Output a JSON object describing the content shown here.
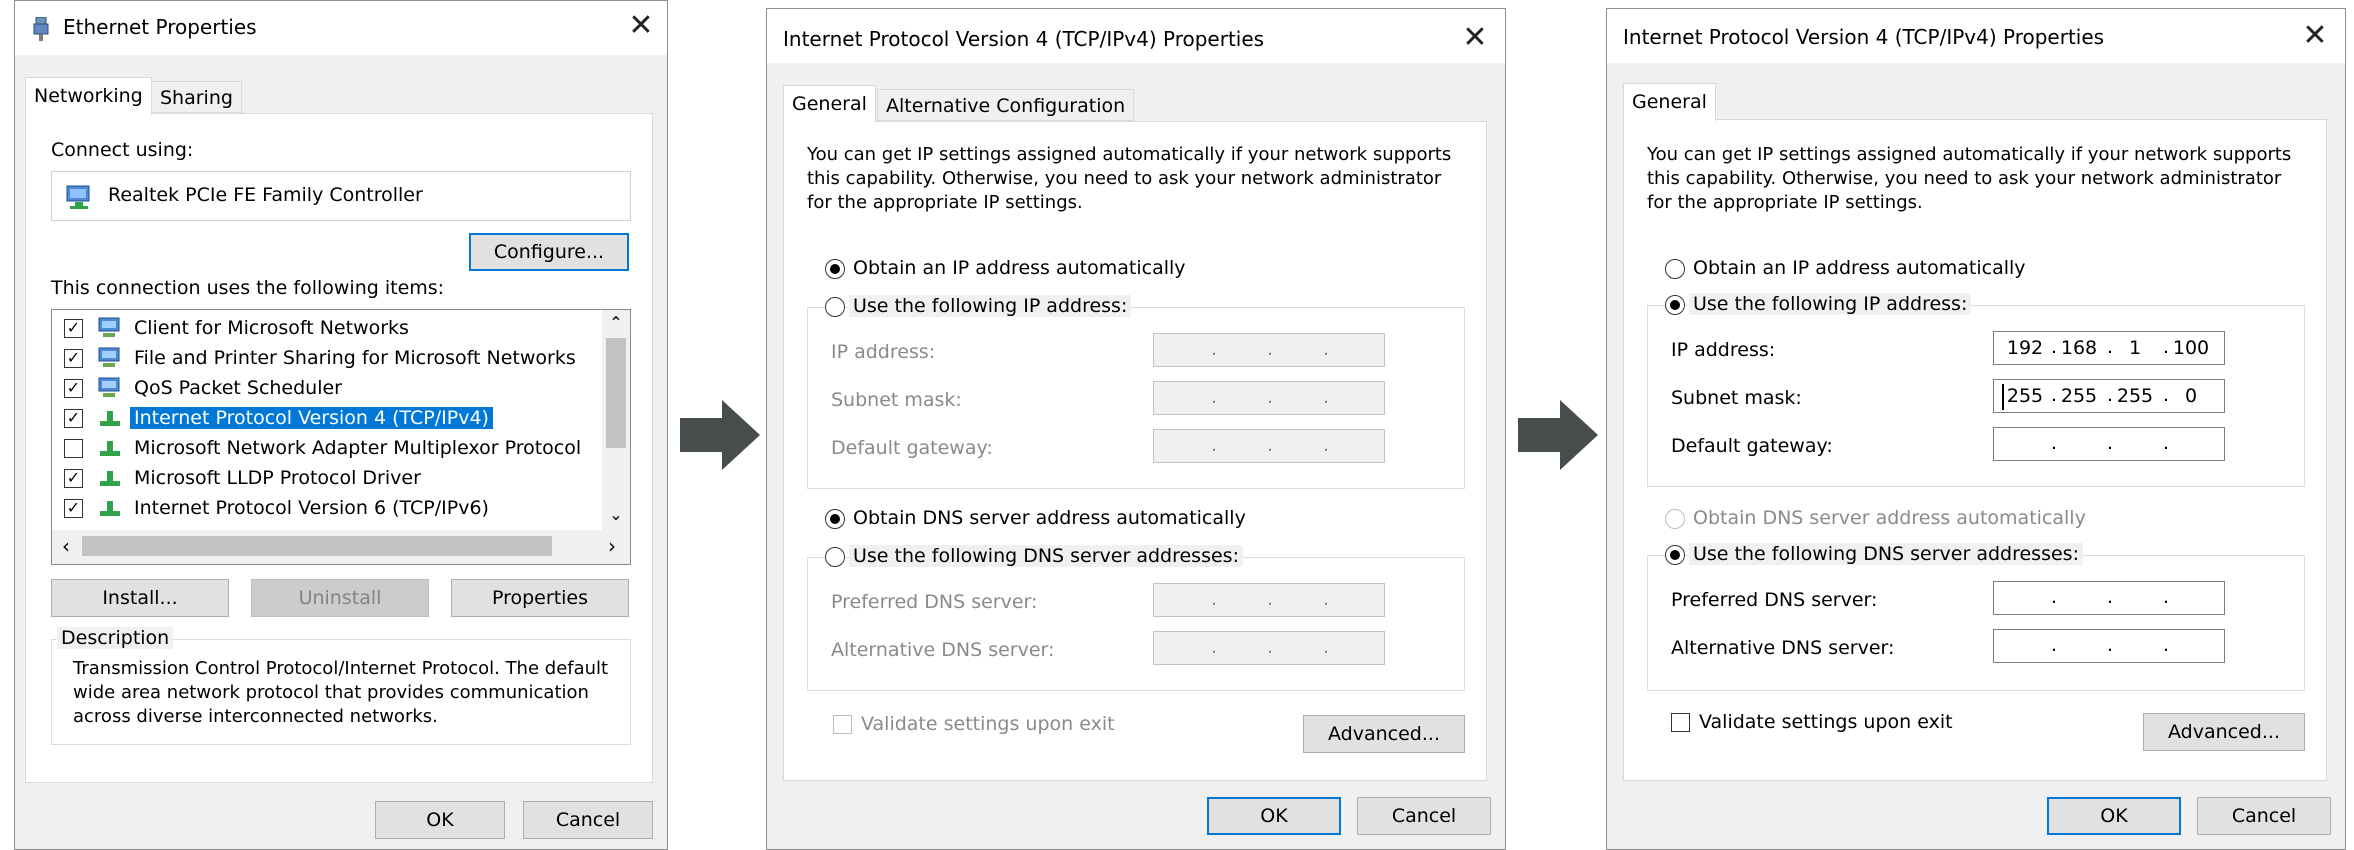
{
  "ethernet": {
    "title": "Ethernet Properties",
    "tabs": [
      "Networking",
      "Sharing"
    ],
    "connect_using_label": "Connect using:",
    "adapter_name": "Realtek PCIe FE Family Controller",
    "configure_button": "Configure...",
    "items_label": "This connection uses the following items:",
    "items": [
      {
        "label": "Client for Microsoft Networks",
        "checked": true
      },
      {
        "label": "File and Printer Sharing for Microsoft Networks",
        "checked": true
      },
      {
        "label": "QoS Packet Scheduler",
        "checked": true
      },
      {
        "label": "Internet Protocol Version 4 (TCP/IPv4)",
        "checked": true,
        "selected": true
      },
      {
        "label": "Microsoft Network Adapter Multiplexor Protocol",
        "checked": false
      },
      {
        "label": "Microsoft LLDP Protocol Driver",
        "checked": true
      },
      {
        "label": "Internet Protocol Version 6 (TCP/IPv6)",
        "checked": true
      }
    ],
    "install_button": "Install...",
    "uninstall_button": "Uninstall",
    "properties_button": "Properties",
    "description_label": "Description",
    "description_text": [
      "Transmission Control Protocol/Internet Protocol. The default",
      "wide area network protocol that provides communication",
      "across diverse interconnected networks."
    ],
    "ok_button": "OK",
    "cancel_button": "Cancel"
  },
  "ipv4_auto": {
    "title": "Internet Protocol Version 4 (TCP/IPv4) Properties",
    "tabs": [
      "General",
      "Alternative Configuration"
    ],
    "intro": [
      "You can get IP settings assigned automatically if your network supports",
      "this capability. Otherwise, you need to ask your network administrator",
      "for the appropriate IP settings."
    ],
    "obtain_ip": "Obtain an IP address automatically",
    "use_ip": "Use the following IP address:",
    "ip_label": "IP address:",
    "subnet_label": "Subnet mask:",
    "gateway_label": "Default gateway:",
    "obtain_dns": "Obtain DNS server address automatically",
    "use_dns": "Use the following DNS server addresses:",
    "pref_dns_label": "Preferred DNS server:",
    "alt_dns_label": "Alternative DNS server:",
    "validate_label": "Validate settings upon exit",
    "advanced_button": "Advanced...",
    "ok_button": "OK",
    "cancel_button": "Cancel"
  },
  "ipv4_static": {
    "title": "Internet Protocol Version 4 (TCP/IPv4) Properties",
    "tabs": [
      "General"
    ],
    "intro": [
      "You can get IP settings assigned automatically if your network supports",
      "this capability. Otherwise, you need to ask your network administrator",
      "for the appropriate IP settings."
    ],
    "obtain_ip": "Obtain an IP address automatically",
    "use_ip": "Use the following IP address:",
    "ip_label": "IP address:",
    "ip_value": [
      "192",
      "168",
      "1",
      "100"
    ],
    "subnet_label": "Subnet mask:",
    "subnet_value": [
      "255",
      "255",
      "255",
      "0"
    ],
    "gateway_label": "Default gateway:",
    "obtain_dns": "Obtain DNS server address automatically",
    "use_dns": "Use the following DNS server addresses:",
    "pref_dns_label": "Preferred DNS server:",
    "alt_dns_label": "Alternative DNS server:",
    "validate_label": "Validate settings upon exit",
    "advanced_button": "Advanced...",
    "ok_button": "OK",
    "cancel_button": "Cancel"
  },
  "icons": {
    "ethernet": "network-adapter-icon",
    "arrow": "arrow-right-icon"
  },
  "colors": {
    "accent": "#0078d7",
    "arrow": "#474d4d"
  }
}
